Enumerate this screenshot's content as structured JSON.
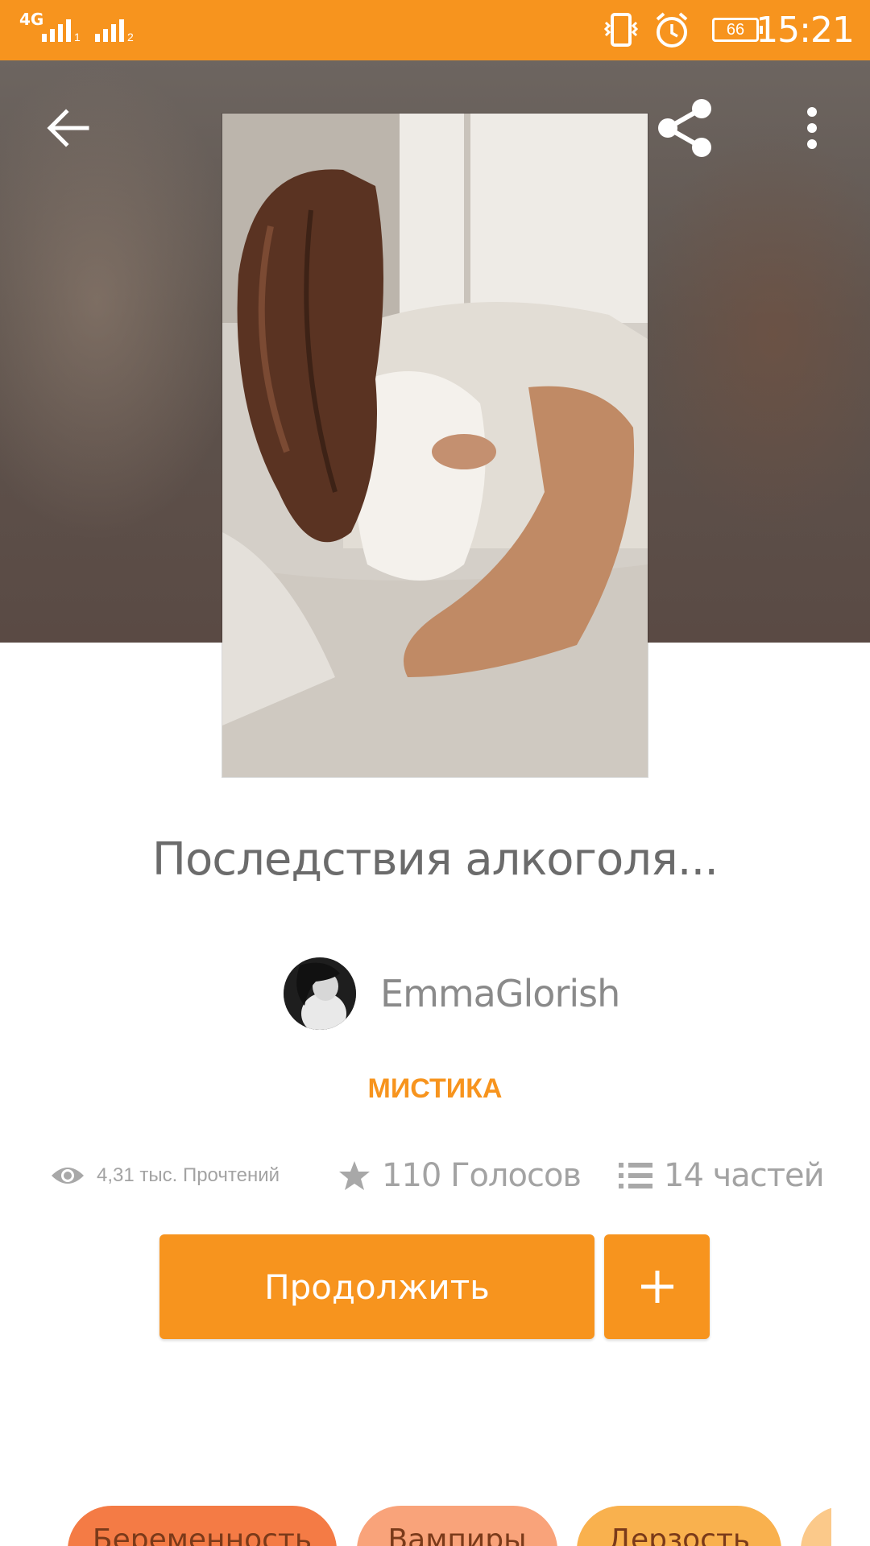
{
  "status_bar": {
    "network": "4G",
    "sim1_label": "1",
    "sim2_label": "2",
    "battery": "66",
    "time": "15:21"
  },
  "header": {
    "back_icon": "arrow-left-icon",
    "share_icon": "share-icon",
    "menu_icon": "more-vert-icon"
  },
  "story": {
    "title": "Последствия алкоголя...",
    "author": "EmmaGlorish",
    "category": "МИСТИКА",
    "reads": "4,31 тыс. Прочтений",
    "votes": "110 Голосов",
    "parts": "14 частей"
  },
  "actions": {
    "continue_label": "Продолжить",
    "add_icon": "plus-icon"
  },
  "tags": [
    {
      "label": "Беременность",
      "color": "#f47b45"
    },
    {
      "label": "Вампиры",
      "color": "#f9a37a"
    },
    {
      "label": "Дерзость",
      "color": "#f9b14e"
    }
  ],
  "colors": {
    "accent": "#f7941e",
    "text_muted": "#a3a3a3"
  }
}
